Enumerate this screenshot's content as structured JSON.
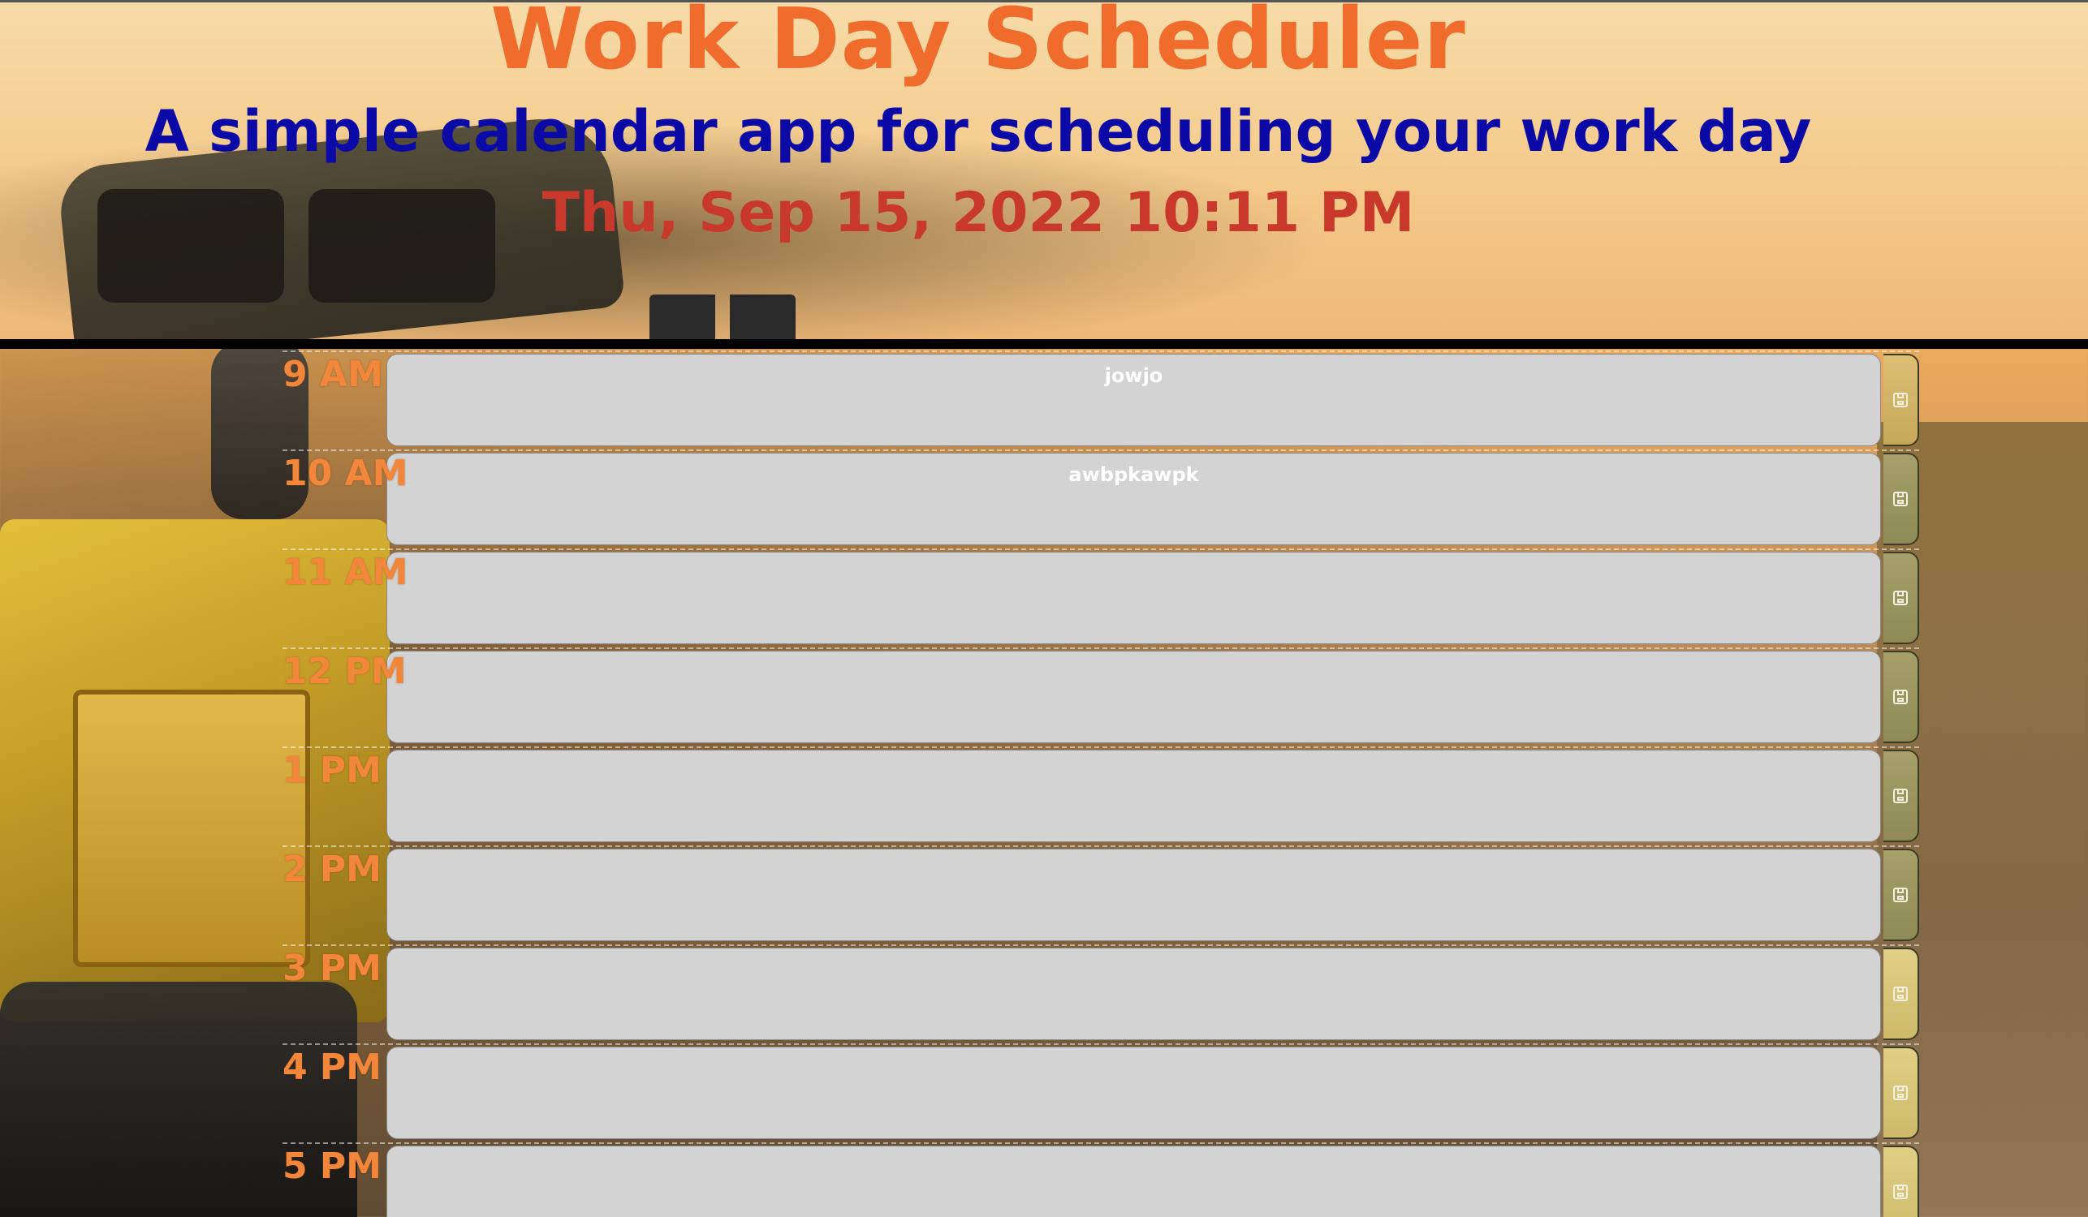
{
  "header": {
    "title": "Work Day Scheduler",
    "subtitle": "A simple calendar app for scheduling your work day",
    "current_datetime": "Thu, Sep 15, 2022 10:11 PM"
  },
  "schedule": {
    "rows": [
      {
        "hour": "9 AM",
        "note": "jowjo"
      },
      {
        "hour": "10 AM",
        "note": "awbpkawpk"
      },
      {
        "hour": "11 AM",
        "note": ""
      },
      {
        "hour": "12 PM",
        "note": ""
      },
      {
        "hour": "1 PM",
        "note": ""
      },
      {
        "hour": "2 PM",
        "note": ""
      },
      {
        "hour": "3 PM",
        "note": ""
      },
      {
        "hour": "4 PM",
        "note": ""
      },
      {
        "hour": "5 PM",
        "note": ""
      }
    ],
    "save_icon": "save-icon"
  },
  "colors": {
    "title": "#f06c2c",
    "subtitle": "#0c0aa6",
    "datetime": "#c8392b",
    "hour_label": "#f2863a",
    "textarea_bg": "#d3d3d3"
  }
}
